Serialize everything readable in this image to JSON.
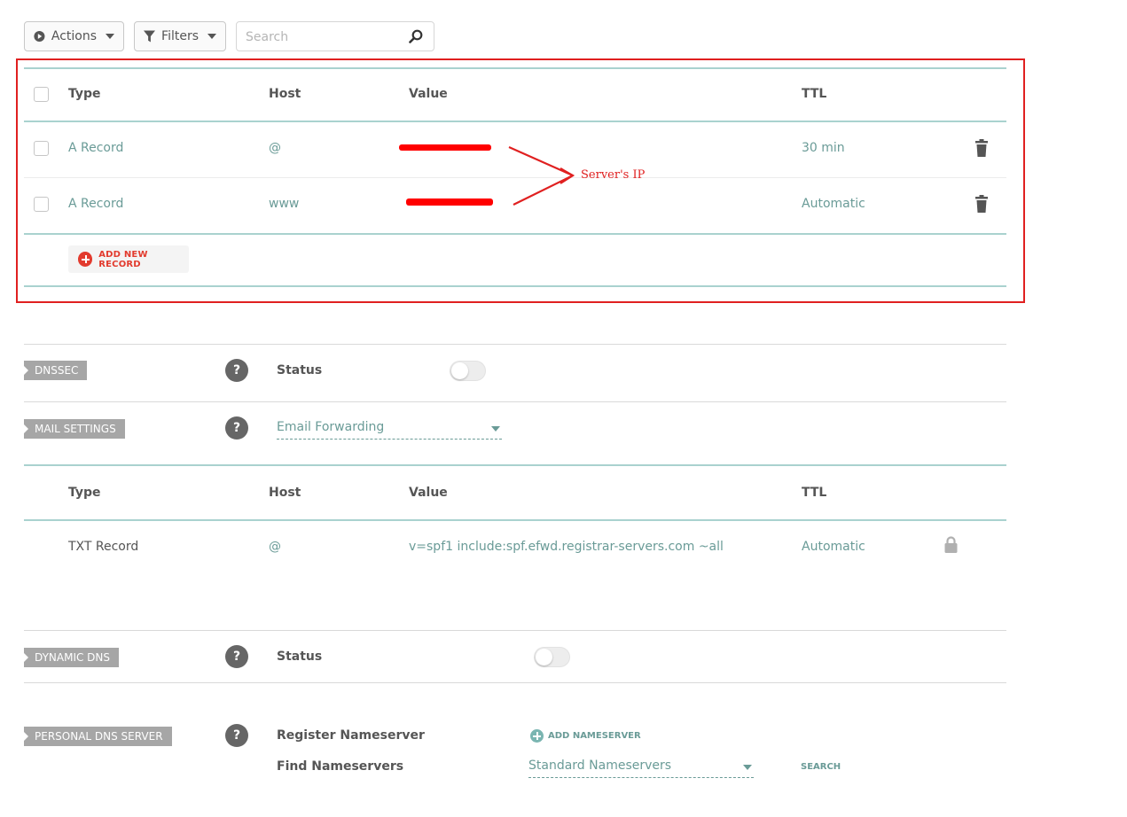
{
  "toolbar": {
    "actions_label": "Actions",
    "filters_label": "Filters",
    "search_placeholder": "Search"
  },
  "host_records": {
    "headers": {
      "type": "Type",
      "host": "Host",
      "value": "Value",
      "ttl": "TTL"
    },
    "rows": [
      {
        "type": "A Record",
        "host": "@",
        "value": "",
        "ttl": "30 min"
      },
      {
        "type": "A Record",
        "host": "www",
        "value": "",
        "ttl": "Automatic"
      }
    ],
    "add_label": "ADD NEW RECORD",
    "annotation": "Server's IP"
  },
  "dnssec": {
    "tag": "DNSSEC",
    "help": "?",
    "status_label": "Status",
    "enabled": false
  },
  "mail": {
    "tag": "MAIL SETTINGS",
    "help": "?",
    "selected": "Email Forwarding",
    "headers": {
      "type": "Type",
      "host": "Host",
      "value": "Value",
      "ttl": "TTL"
    },
    "rows": [
      {
        "type": "TXT Record",
        "host": "@",
        "value": "v=spf1 include:spf.efwd.registrar-servers.com ~all",
        "ttl": "Automatic"
      }
    ]
  },
  "dynamic_dns": {
    "tag": "DYNAMIC DNS",
    "help": "?",
    "status_label": "Status",
    "enabled": false
  },
  "personal_dns": {
    "tag": "PERSONAL DNS SERVER",
    "help": "?",
    "register_label": "Register Nameserver",
    "add_nameserver_label": "ADD NAMESERVER",
    "find_label": "Find Nameservers",
    "find_selected": "Standard Nameservers",
    "search_label": "SEARCH"
  },
  "colors": {
    "accent_teal": "#6a9b97",
    "annotation_red": "#e02020",
    "add_red": "#e23b2e",
    "tag_grey": "#a6a6a6"
  }
}
